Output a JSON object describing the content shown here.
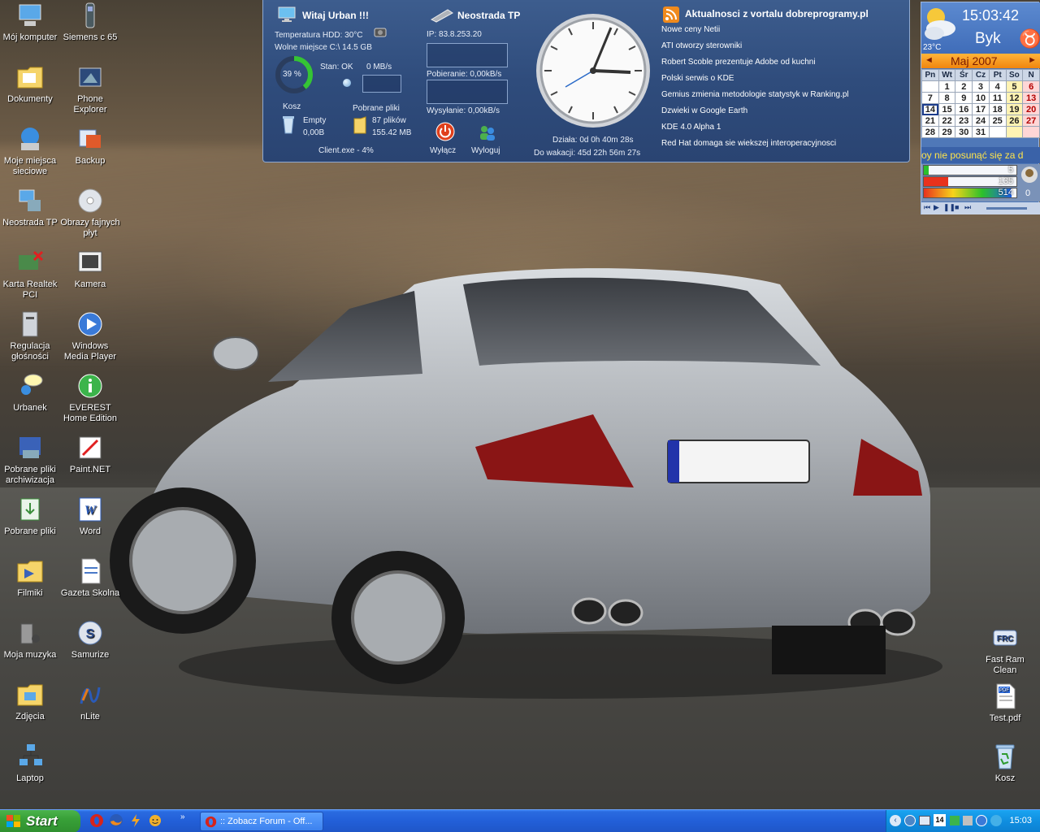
{
  "desktop_icons_left": [
    {
      "label": "Mój komputer",
      "icon": "my-computer-icon"
    },
    {
      "label": "Siemens c 65",
      "icon": "phone-icon"
    },
    {
      "label": "Dokumenty",
      "icon": "documents-folder-icon"
    },
    {
      "label": "Phone Explorer",
      "icon": "phone-explorer-icon"
    },
    {
      "label": "Moje miejsca sieciowe",
      "icon": "network-places-icon"
    },
    {
      "label": "Backup",
      "icon": "backup-icon"
    },
    {
      "label": "Neostrada TP",
      "icon": "network-connection-icon"
    },
    {
      "label": "Obrazy fajnych płyt",
      "icon": "cd-disc-icon"
    },
    {
      "label": "Karta Realtek PCI",
      "icon": "network-card-icon"
    },
    {
      "label": "Kamera",
      "icon": "camera-icon"
    },
    {
      "label": "Regulacja głośności",
      "icon": "volume-control-icon"
    },
    {
      "label": "Windows Media Player",
      "icon": "media-player-icon"
    },
    {
      "label": "Urbanek",
      "icon": "user-chat-icon"
    },
    {
      "label": "EVEREST Home Edition",
      "icon": "info-icon"
    },
    {
      "label": "Pobrane pliki archiwizacja",
      "icon": "archive-icon"
    },
    {
      "label": "Paint.NET",
      "icon": "paint-icon"
    },
    {
      "label": "Pobrane pliki",
      "icon": "downloads-icon"
    },
    {
      "label": "Word",
      "icon": "word-icon"
    },
    {
      "label": "Filmiki",
      "icon": "video-folder-icon"
    },
    {
      "label": "Gazeta Skolna",
      "icon": "document-icon"
    },
    {
      "label": "Moja muzyka",
      "icon": "music-icon"
    },
    {
      "label": "Samurize",
      "icon": "samurize-icon"
    },
    {
      "label": "Zdjęcia",
      "icon": "photos-folder-icon"
    },
    {
      "label": "nLite",
      "icon": "nlite-icon"
    },
    {
      "label": "Laptop",
      "icon": "laptop-network-icon"
    }
  ],
  "desktop_icons_right": [
    {
      "label": "Fast Ram Clean",
      "icon": "fast-ram-clean-icon"
    },
    {
      "label": "Test.pdf",
      "icon": "pdf-icon"
    },
    {
      "label": "Kosz",
      "icon": "recycle-bin-icon"
    }
  ],
  "panel": {
    "welcome_title": "Witaj Urban !!!",
    "hdd_temp": "Temperatura HDD: 30°C",
    "free_space": "Wolne miejsce C:\\  14.5 GB",
    "cpu_percent": "39 %",
    "cpu_fraction": 0.39,
    "status": "Stan: OK",
    "speed": "0 MB/s",
    "recycle_label": "Kosz",
    "recycle_state": "Empty",
    "recycle_size": "0,00B",
    "downloads_label": "Pobrane pliki",
    "downloads_count": "87 plików",
    "downloads_size": "155.42 MB",
    "client": "Client.exe - 4%",
    "neostrada_title": "Neostrada TP",
    "ip": "IP: 83.8.253.20",
    "download_rate": "Pobieranie: 0,00kB/s",
    "upload_rate": "Wysyłanie: 0,00kB/s",
    "shutdown_label": "Wyłącz",
    "logout_label": "Wyloguj",
    "uptime": "Działa: 0d 0h 40m 28s",
    "vacation": "Do wakacji: 45d 22h 56m 27s",
    "news_title": "Aktualnosci z vortalu dobreprogramy.pl",
    "news": [
      "Nowe ceny Netii",
      "ATI otworzy sterowniki",
      "Robert Scoble prezentuje Adobe od kuchni",
      "Polski serwis o KDE",
      "Gemius zmienia metodologie statystyk w Ranking.pl",
      "Dzwieki w Google Earth",
      "KDE 4.0 Alpha 1",
      "Red Hat domaga sie wiekszej interoperacyjnosci"
    ]
  },
  "gadget": {
    "time": "15:03:42",
    "sign": "Byk",
    "temperature": "23°C",
    "month": "Maj 2007",
    "weekdays": [
      "Pn",
      "Wt",
      "Śr",
      "Cz",
      "Pt",
      "So",
      "N"
    ],
    "weeks": [
      [
        "",
        "1",
        "2",
        "3",
        "4",
        "5",
        "6"
      ],
      [
        "7",
        "8",
        "9",
        "10",
        "11",
        "12",
        "13"
      ],
      [
        "14",
        "15",
        "16",
        "17",
        "18",
        "19",
        "20"
      ],
      [
        "21",
        "22",
        "23",
        "24",
        "25",
        "26",
        "27"
      ],
      [
        "28",
        "29",
        "30",
        "31",
        "",
        "",
        ""
      ]
    ],
    "ticker": "oy nie posunąć się za d",
    "bars": [
      {
        "value": "5",
        "level": 0.05
      },
      {
        "value": "135",
        "level": 0.26
      },
      {
        "value": "514",
        "level": 0.95
      }
    ],
    "bar_side_values": [
      "0"
    ]
  },
  "taskbar": {
    "start_label": "Start",
    "task_label": ":: Zobacz Forum - Off...",
    "clock": "15:03"
  },
  "colors": {
    "panel_bg": "#2f4c7c",
    "taskbar_blue": "#225fd8",
    "start_green": "#38a038",
    "tray_blue": "#0f8ee0"
  }
}
